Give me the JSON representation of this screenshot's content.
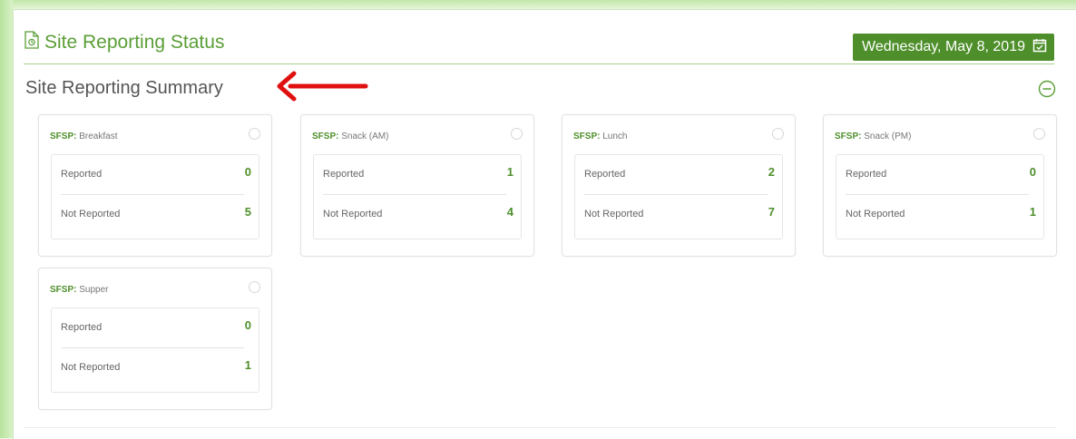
{
  "header": {
    "title": "Site Reporting Status",
    "date": "Wednesday, May 8, 2019"
  },
  "summary": {
    "title": "Site Reporting Summary"
  },
  "colors": {
    "accent": "#5a9e36",
    "badge_bg": "#4e8f2b",
    "arrow": "#e01010"
  },
  "cards": [
    {
      "program": "SFSP:",
      "meal": "Breakfast",
      "reported_label": "Reported",
      "reported": "0",
      "not_reported_label": "Not Reported",
      "not_reported": "5"
    },
    {
      "program": "SFSP:",
      "meal": "Snack (AM)",
      "reported_label": "Reported",
      "reported": "1",
      "not_reported_label": "Not Reported",
      "not_reported": "4"
    },
    {
      "program": "SFSP:",
      "meal": "Lunch",
      "reported_label": "Reported",
      "reported": "2",
      "not_reported_label": "Not Reported",
      "not_reported": "7"
    },
    {
      "program": "SFSP:",
      "meal": "Snack (PM)",
      "reported_label": "Reported",
      "reported": "0",
      "not_reported_label": "Not Reported",
      "not_reported": "1"
    },
    {
      "program": "SFSP:",
      "meal": "Supper",
      "reported_label": "Reported",
      "reported": "0",
      "not_reported_label": "Not Reported",
      "not_reported": "1"
    }
  ],
  "icons": {
    "header": "document-icon",
    "date": "calendar-icon",
    "collapse": "minus-circle-icon",
    "annotation": "red-arrow-left-icon"
  }
}
